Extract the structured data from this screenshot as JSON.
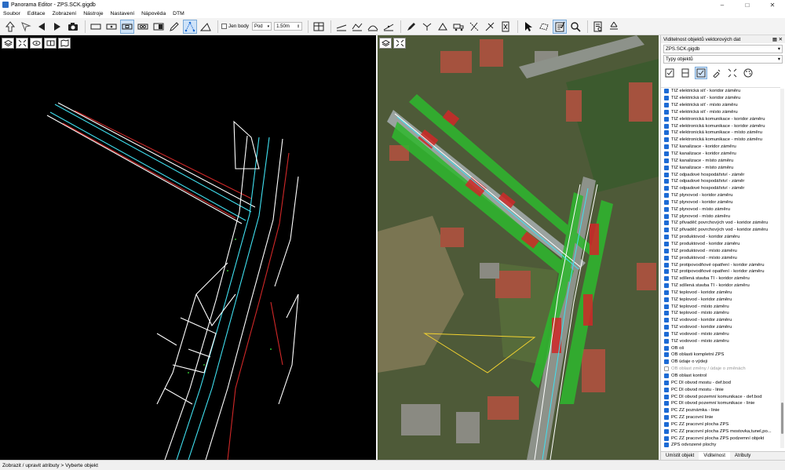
{
  "window": {
    "title": "Panorama Editor - ZPS.SCK.gigdb"
  },
  "menu": [
    "Soubor",
    "Editace",
    "Zobrazení",
    "Nástroje",
    "Nastavení",
    "Nápověda",
    "DTM"
  ],
  "toolbar": {
    "jen_body_label": "Jen body",
    "pod_value": "Pod",
    "distance_value": "1.50m"
  },
  "panel": {
    "title": "Viditelnost objektů vektorových dat",
    "file_combo": "ZPS.SCK.gigdb",
    "type_combo": "Typy objektů",
    "items": [
      {
        "label": "TIZ elektrická síť - koridor záměru",
        "checked": true
      },
      {
        "label": "TIZ elektrická síť - koridor záměru",
        "checked": true
      },
      {
        "label": "TIZ elektrická síť - místo záměru",
        "checked": true
      },
      {
        "label": "TIZ elektrická síť - místo záměru",
        "checked": true
      },
      {
        "label": "TIZ elektronická komunikace - koridor záměru",
        "checked": true
      },
      {
        "label": "TIZ elektronická komunikace - koridor záměru",
        "checked": true
      },
      {
        "label": "TIZ elektronická komunikace - místo záměru",
        "checked": true
      },
      {
        "label": "TIZ elektronická komunikace - místo záměru",
        "checked": true
      },
      {
        "label": "TIZ kanalizace - koridor záměru",
        "checked": true
      },
      {
        "label": "TIZ kanalizace - koridor záměru",
        "checked": true
      },
      {
        "label": "TIZ kanalizace - místo záměru",
        "checked": true
      },
      {
        "label": "TIZ kanalizace - místo záměru",
        "checked": true
      },
      {
        "label": "TIZ odpadové hospodářství - záměr",
        "checked": true
      },
      {
        "label": "TIZ odpadové hospodářství - záměr",
        "checked": true
      },
      {
        "label": "TIZ odpadové hospodářství - záměr",
        "checked": true
      },
      {
        "label": "TIZ plynovod - koridor záměru",
        "checked": true
      },
      {
        "label": "TIZ plynovod - koridor záměru",
        "checked": true
      },
      {
        "label": "TIZ plynovod - místo záměru",
        "checked": true
      },
      {
        "label": "TIZ plynovod - místo záměru",
        "checked": true
      },
      {
        "label": "TIZ přivaděč povrchových vod - koridor záměru",
        "checked": true
      },
      {
        "label": "TIZ přivaděč povrchových vod - koridor záměru",
        "checked": true
      },
      {
        "label": "TIZ produktovod - koridor záměru",
        "checked": true
      },
      {
        "label": "TIZ produktovod - koridor záměru",
        "checked": true
      },
      {
        "label": "TIZ produktovod - místo záměru",
        "checked": true
      },
      {
        "label": "TIZ produktovod - místo záměru",
        "checked": true
      },
      {
        "label": "TIZ protipovodňové opatření - koridor záměru",
        "checked": true
      },
      {
        "label": "TIZ protipovodňové opatření - koridor záměru",
        "checked": true
      },
      {
        "label": "TIZ sdílená stavba TI - koridor záměru",
        "checked": true
      },
      {
        "label": "TIZ sdílená stavba TI - koridor záměru",
        "checked": true
      },
      {
        "label": "TIZ teplovod - koridor záměru",
        "checked": true
      },
      {
        "label": "TIZ teplovod - koridor záměru",
        "checked": true
      },
      {
        "label": "TIZ teplovod - místo záměru",
        "checked": true
      },
      {
        "label": "TIZ teplovod - místo záměru",
        "checked": true
      },
      {
        "label": "TIZ vodovod - koridor záměru",
        "checked": true
      },
      {
        "label": "TIZ vodovod - koridor záměru",
        "checked": true
      },
      {
        "label": "TIZ vodovod - místo záměru",
        "checked": true
      },
      {
        "label": "TIZ vodovod - místo záměru",
        "checked": true
      },
      {
        "label": "OB oš",
        "checked": true
      },
      {
        "label": "OB oblasti kompletní ZPS",
        "checked": true
      },
      {
        "label": "OB údaje o výdeji",
        "checked": true
      },
      {
        "label": "OB oblast změny / údaje o změnách",
        "checked": false,
        "disabled": true
      },
      {
        "label": "OB oblast kontrol",
        "checked": true
      },
      {
        "label": "PC DI obvod mostu - def.bod",
        "checked": true
      },
      {
        "label": "PC DI obvod mostu - linie",
        "checked": true
      },
      {
        "label": "PC DI obvod pozemní komunikace - def.bod",
        "checked": true
      },
      {
        "label": "PC DI obvod pozemní komunikace - linie",
        "checked": true
      },
      {
        "label": "PC ZZ poznámka - linie",
        "checked": true
      },
      {
        "label": "PC ZZ pracovní linie",
        "checked": true
      },
      {
        "label": "PC ZZ pracovní plocha ZPS",
        "checked": true
      },
      {
        "label": "PC ZZ pracovní plocha ZPS mostovka,tunel,po...",
        "checked": true
      },
      {
        "label": "PC ZZ pracovní plocha ZPS podzemní objekt",
        "checked": true
      },
      {
        "label": "ZPS odvozené plochy",
        "checked": true
      }
    ],
    "tabs": [
      "Umístit objekt",
      "Viditelnost",
      "Atributy"
    ]
  },
  "status": {
    "text": "Zobrazit / upravit atributy > Vyberte objekt"
  },
  "colors": {
    "accent": "#1d6bd4",
    "cad_background": "#000000",
    "road_cyan": "#40e0f0",
    "planned_red": "#d02828",
    "planned_green": "#2eb82e"
  }
}
